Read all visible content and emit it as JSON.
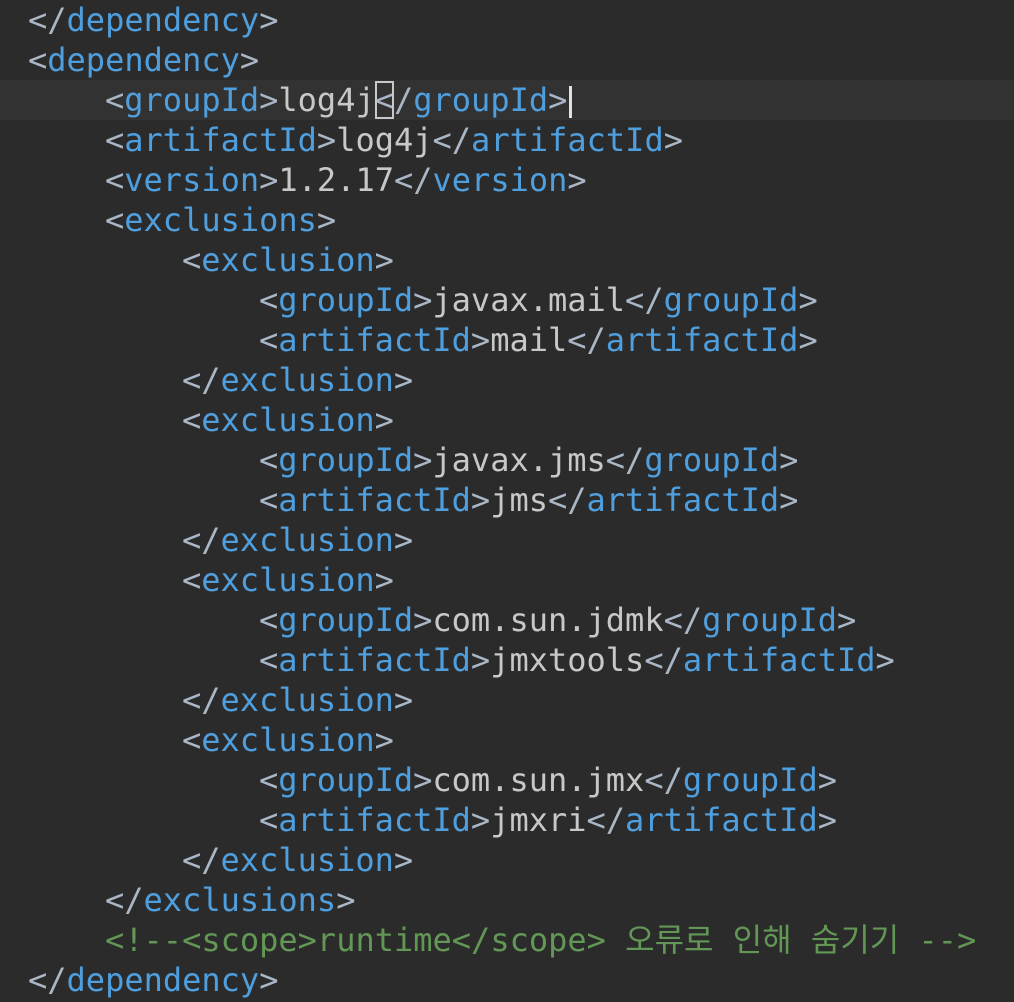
{
  "editor": {
    "language": "xml",
    "theme": {
      "background": "#2b2b2b",
      "current_line": "#323232",
      "bracket_color": "#a9b7c6",
      "tag_color": "#4f9fde",
      "value_color": "#c8c8c8",
      "comment_color": "#629755"
    },
    "lines": [
      {
        "open": "</",
        "tag": "dependency",
        "close": ">"
      },
      {
        "open": "<",
        "tag": "dependency",
        "close": ">"
      },
      {
        "open": "<",
        "tag": "groupId",
        "close": ">",
        "value": "log4j",
        "end_open": "</",
        "end_tag": "groupId",
        "end_close": ">"
      },
      {
        "open": "<",
        "tag": "artifactId",
        "close": ">",
        "value": "log4j",
        "end_open": "</",
        "end_tag": "artifactId",
        "end_close": ">"
      },
      {
        "open": "<",
        "tag": "version",
        "close": ">",
        "value": "1.2.17",
        "end_open": "</",
        "end_tag": "version",
        "end_close": ">"
      },
      {
        "open": "<",
        "tag": "exclusions",
        "close": ">"
      },
      {
        "open": "<",
        "tag": "exclusion",
        "close": ">"
      },
      {
        "open": "<",
        "tag": "groupId",
        "close": ">",
        "value": "javax.mail",
        "end_open": "</",
        "end_tag": "groupId",
        "end_close": ">"
      },
      {
        "open": "<",
        "tag": "artifactId",
        "close": ">",
        "value": "mail",
        "end_open": "</",
        "end_tag": "artifactId",
        "end_close": ">"
      },
      {
        "open": "</",
        "tag": "exclusion",
        "close": ">"
      },
      {
        "open": "<",
        "tag": "exclusion",
        "close": ">"
      },
      {
        "open": "<",
        "tag": "groupId",
        "close": ">",
        "value": "javax.jms",
        "end_open": "</",
        "end_tag": "groupId",
        "end_close": ">"
      },
      {
        "open": "<",
        "tag": "artifactId",
        "close": ">",
        "value": "jms",
        "end_open": "</",
        "end_tag": "artifactId",
        "end_close": ">"
      },
      {
        "open": "</",
        "tag": "exclusion",
        "close": ">"
      },
      {
        "open": "<",
        "tag": "exclusion",
        "close": ">"
      },
      {
        "open": "<",
        "tag": "groupId",
        "close": ">",
        "value": "com.sun.jdmk",
        "end_open": "</",
        "end_tag": "groupId",
        "end_close": ">"
      },
      {
        "open": "<",
        "tag": "artifactId",
        "close": ">",
        "value": "jmxtools",
        "end_open": "</",
        "end_tag": "artifactId",
        "end_close": ">"
      },
      {
        "open": "</",
        "tag": "exclusion",
        "close": ">"
      },
      {
        "open": "<",
        "tag": "exclusion",
        "close": ">"
      },
      {
        "open": "<",
        "tag": "groupId",
        "close": ">",
        "value": "com.sun.jmx",
        "end_open": "</",
        "end_tag": "groupId",
        "end_close": ">"
      },
      {
        "open": "<",
        "tag": "artifactId",
        "close": ">",
        "value": "jmxri",
        "end_open": "</",
        "end_tag": "artifactId",
        "end_close": ">"
      },
      {
        "open": "</",
        "tag": "exclusion",
        "close": ">"
      },
      {
        "open": "</",
        "tag": "exclusions",
        "close": ">"
      },
      {
        "comment": "<!--<scope>runtime</scope> 오류로 인해 숨기기 -->"
      },
      {
        "open": "</",
        "tag": "dependency",
        "close": ">"
      }
    ]
  }
}
